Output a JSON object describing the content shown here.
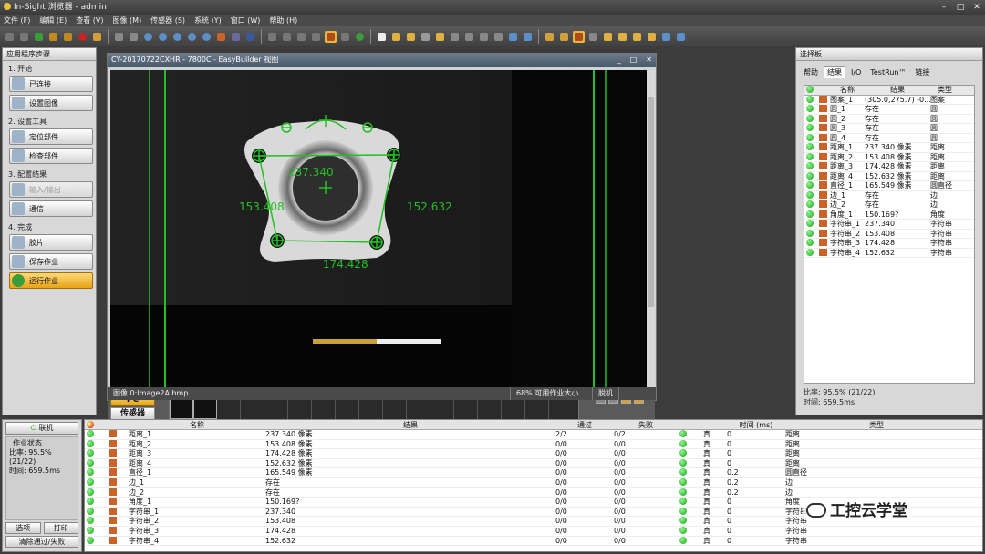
{
  "window": {
    "title": "In-Sight 浏览器 - admin",
    "controls": [
      "–",
      "□",
      "✕"
    ]
  },
  "menu": [
    "文件 (F)",
    "编辑 (E)",
    "查看 (V)",
    "图像 (M)",
    "传感器 (S)",
    "系统 (Y)",
    "窗口 (W)",
    "帮助 (H)"
  ],
  "steps_panel": {
    "title": "应用程序步骤",
    "sections": [
      {
        "label": "1. 开始",
        "buttons": [
          {
            "label": "已连接",
            "state": "normal"
          },
          {
            "label": "设置图像",
            "state": "normal"
          }
        ]
      },
      {
        "label": "2. 设置工具",
        "buttons": [
          {
            "label": "定位部件",
            "state": "normal"
          },
          {
            "label": "检查部件",
            "state": "normal"
          }
        ]
      },
      {
        "label": "3. 配置结果",
        "buttons": [
          {
            "label": "输入/输出",
            "state": "disabled"
          },
          {
            "label": "通信",
            "state": "normal"
          }
        ]
      },
      {
        "label": "4. 完成",
        "buttons": [
          {
            "label": "胶片",
            "state": "normal"
          },
          {
            "label": "保存作业",
            "state": "normal"
          },
          {
            "label": "运行作业",
            "state": "active"
          }
        ]
      }
    ]
  },
  "viewer": {
    "title": "CY-20170722CXHR - 7800C - EasyBuilder 视图",
    "controls": [
      "_",
      "□",
      "✕"
    ],
    "measurements": {
      "top": "237.340",
      "left": "153.408",
      "right": "152.632",
      "bottom": "174.428"
    },
    "pc_label": "PC",
    "sensor_label": "传感器",
    "status": {
      "image": "图像 0:Image2A.bmp",
      "capacity": "68% 可用作业大小",
      "mode": "脱机"
    }
  },
  "palette": {
    "title": "选择板",
    "tabs": [
      {
        "label": "帮助",
        "selected": false
      },
      {
        "label": "结果",
        "selected": true
      },
      {
        "label": "I/O",
        "selected": false
      },
      {
        "label": "TestRun™",
        "selected": false
      },
      {
        "label": "链接",
        "selected": false
      }
    ],
    "columns": [
      "",
      "",
      "名称",
      "结果",
      "类型"
    ],
    "rows": [
      {
        "name": "图案_1",
        "result": "(305.0,275.7) -0...",
        "type": "图案"
      },
      {
        "name": "圆_1",
        "result": "存在",
        "type": "圆"
      },
      {
        "name": "圆_2",
        "result": "存在",
        "type": "圆"
      },
      {
        "name": "圆_3",
        "result": "存在",
        "type": "圆"
      },
      {
        "name": "圆_4",
        "result": "存在",
        "type": "圆"
      },
      {
        "name": "距离_1",
        "result": "237.340 像素",
        "type": "距离"
      },
      {
        "name": "距离_2",
        "result": "153.408 像素",
        "type": "距离"
      },
      {
        "name": "距离_3",
        "result": "174.428 像素",
        "type": "距离"
      },
      {
        "name": "距离_4",
        "result": "152.632 像素",
        "type": "距离"
      },
      {
        "name": "直径_1",
        "result": "165.549 像素",
        "type": "圆直径"
      },
      {
        "name": "边_1",
        "result": "存在",
        "type": "边"
      },
      {
        "name": "边_2",
        "result": "存在",
        "type": "边"
      },
      {
        "name": "角度_1",
        "result": "150.169?",
        "type": "角度"
      },
      {
        "name": "字符串_1",
        "result": "237.340",
        "type": "字符串"
      },
      {
        "name": "字符串_2",
        "result": "153.408",
        "type": "字符串"
      },
      {
        "name": "字符串_3",
        "result": "174.428",
        "type": "字符串"
      },
      {
        "name": "字符串_4",
        "result": "152.632",
        "type": "字符串"
      }
    ],
    "stats": {
      "rate": "比率:  95.5% (21/22)",
      "time": "时间:  659.5ms"
    }
  },
  "job_panel": {
    "online_label": "联机",
    "status_title": "作业状态",
    "rate_label": "比率:  95.5%",
    "rate_detail": "(21/22)",
    "time_label": "时间:  659.5ms",
    "options_label": "选项",
    "print_label": "打印",
    "clear_label": "清除通过/失败"
  },
  "results_table": {
    "columns": [
      "",
      "",
      "名称",
      "结果",
      "通过",
      "失败",
      "",
      "",
      "时间 (ms)",
      "类型"
    ],
    "rows": [
      {
        "name": "距离_1",
        "result": "237.340 像素",
        "pass": "2/2",
        "fail": "0/2",
        "bool": "真",
        "time": "0",
        "type": "距离"
      },
      {
        "name": "距离_2",
        "result": "153.408 像素",
        "pass": "0/0",
        "fail": "0/0",
        "bool": "真",
        "time": "0",
        "type": "距离"
      },
      {
        "name": "距离_3",
        "result": "174.428 像素",
        "pass": "0/0",
        "fail": "0/0",
        "bool": "真",
        "time": "0",
        "type": "距离"
      },
      {
        "name": "距离_4",
        "result": "152.632 像素",
        "pass": "0/0",
        "fail": "0/0",
        "bool": "真",
        "time": "0",
        "type": "距离"
      },
      {
        "name": "直径_1",
        "result": "165.549 像素",
        "pass": "0/0",
        "fail": "0/0",
        "bool": "真",
        "time": "0.2",
        "type": "圆直径"
      },
      {
        "name": "边_1",
        "result": "存在",
        "pass": "0/0",
        "fail": "0/0",
        "bool": "真",
        "time": "0.2",
        "type": "边"
      },
      {
        "name": "边_2",
        "result": "存在",
        "pass": "0/0",
        "fail": "0/0",
        "bool": "真",
        "time": "0.2",
        "type": "边"
      },
      {
        "name": "角度_1",
        "result": "150.169?",
        "pass": "0/0",
        "fail": "0/0",
        "bool": "真",
        "time": "0",
        "type": "角度"
      },
      {
        "name": "字符串_1",
        "result": "237.340",
        "pass": "0/0",
        "fail": "0/0",
        "bool": "真",
        "time": "0",
        "type": "字符串"
      },
      {
        "name": "字符串_2",
        "result": "153.408",
        "pass": "0/0",
        "fail": "0/0",
        "bool": "真",
        "time": "0",
        "type": "字符串"
      },
      {
        "name": "字符串_3",
        "result": "174.428",
        "pass": "0/0",
        "fail": "0/0",
        "bool": "真",
        "time": "0",
        "type": "字符串"
      },
      {
        "name": "字符串_4",
        "result": "152.632",
        "pass": "0/0",
        "fail": "0/0",
        "bool": "真",
        "time": "0",
        "type": "字符串"
      }
    ]
  },
  "watermark": "工控云学堂",
  "colors": {
    "accent": "#e6b83a",
    "pass_green": "#19a219",
    "overlay_green": "#22c022",
    "title_blue": "#4b5a6a"
  }
}
